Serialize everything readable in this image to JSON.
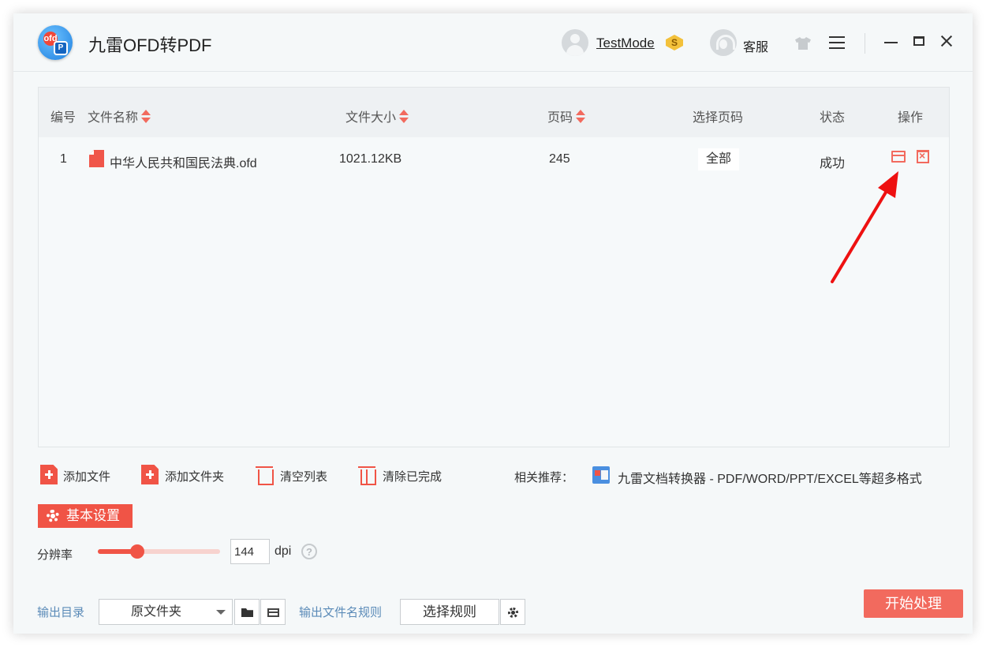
{
  "app": {
    "title": "九雷OFD转PDF",
    "logo_letters": [
      "ofd",
      "P"
    ]
  },
  "header": {
    "user_name": "TestMode",
    "vip_badge": "S",
    "service_label": "客服"
  },
  "table": {
    "columns": {
      "index": "编号",
      "name": "文件名称",
      "size": "文件大小",
      "pages": "页码",
      "select_pages": "选择页码",
      "status": "状态",
      "actions": "操作"
    },
    "rows": [
      {
        "index": "1",
        "name": "中华人民共和国民法典.ofd",
        "size": "1021.12KB",
        "pages": "245",
        "select_pages": "全部",
        "status": "成功"
      }
    ]
  },
  "toolbar": {
    "add_file": "添加文件",
    "add_folder": "添加文件夹",
    "clear_list": "清空列表",
    "clear_done": "清除已完成",
    "recommend_label": "相关推荐：",
    "recommend_text": "九雷文档转换器 - PDF/WORD/PPT/EXCEL等超多格式"
  },
  "settings": {
    "tab_label": "基本设置",
    "resolution_label": "分辨率",
    "resolution_value": "144",
    "resolution_fraction": 0.32,
    "dpi_unit": "dpi",
    "help_glyph": "?"
  },
  "output": {
    "dir_label": "输出目录",
    "dir_value": "原文件夹",
    "filename_rule_label": "输出文件名规则",
    "select_rule_button": "选择规则",
    "start_button": "开始处理"
  },
  "colors": {
    "accent": "#f05446",
    "button_start": "#f26a5e",
    "link_blue": "#5b8bb8",
    "annotation_arrow": "#ee1111"
  },
  "icons": [
    "shirt-icon",
    "menu-icon",
    "minimize-icon",
    "maximize-icon",
    "close-icon",
    "sort-icon",
    "file-icon",
    "open-folder-icon",
    "delete-icon",
    "gear-icon",
    "help-icon",
    "folder-icon",
    "caret-down-icon"
  ]
}
